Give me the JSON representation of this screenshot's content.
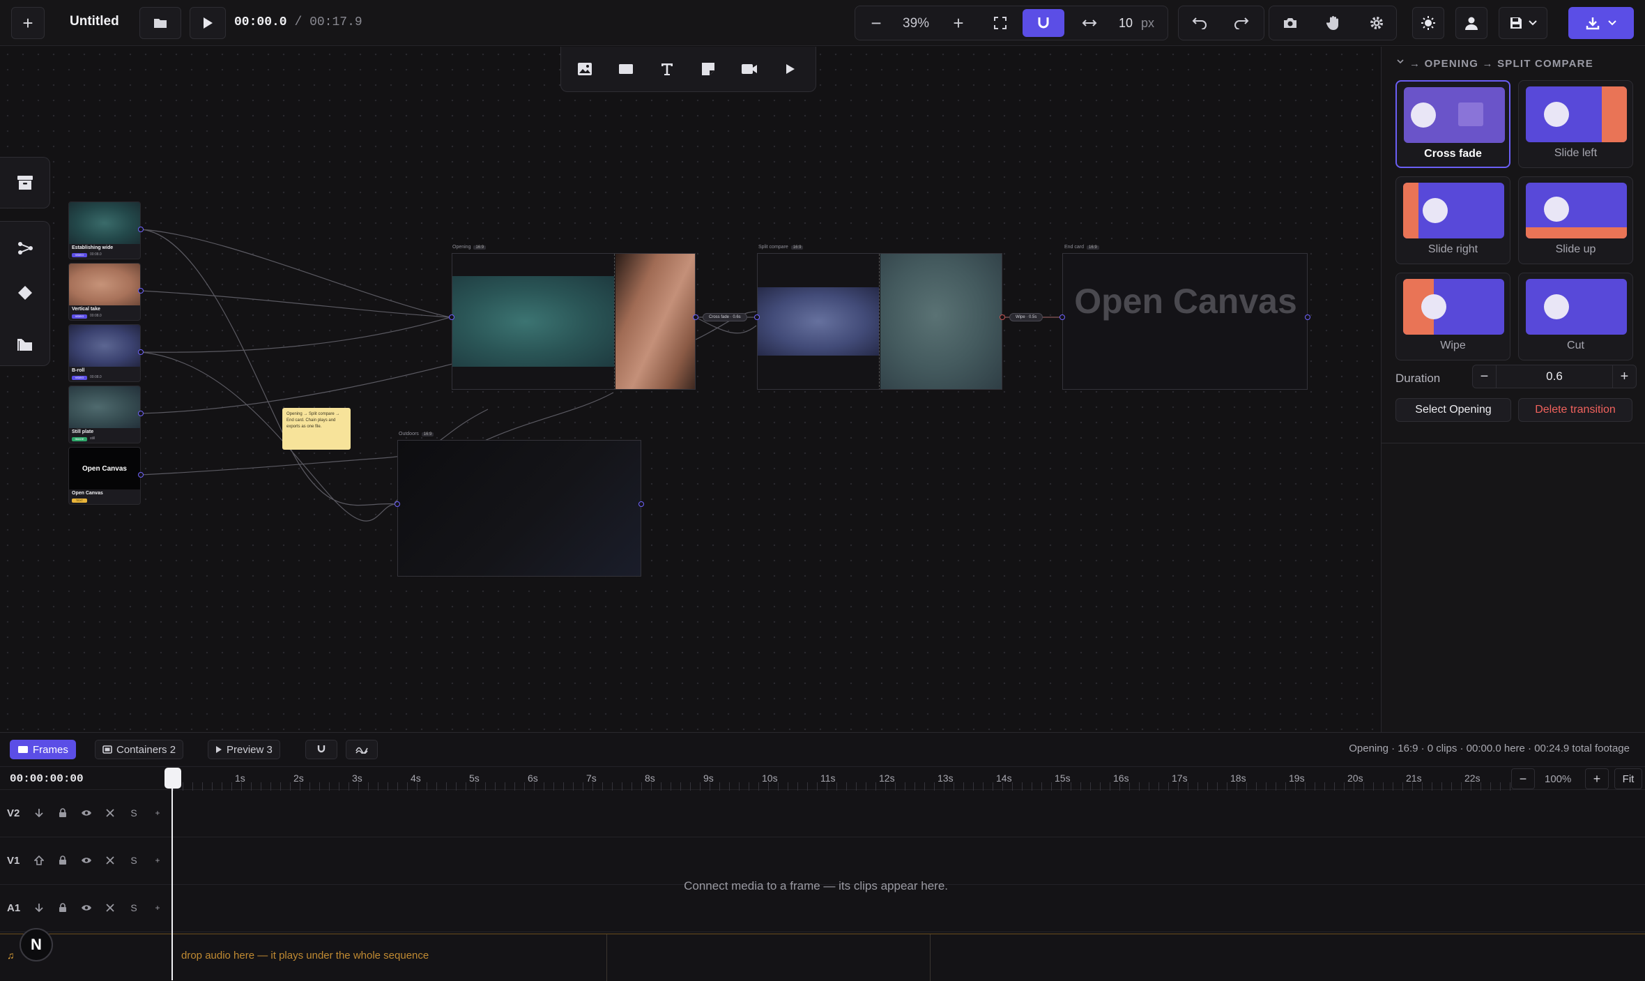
{
  "topbar": {
    "new_label": "+",
    "doc_title": "Untitled",
    "time_current": "00:00.0",
    "time_sep": "/",
    "time_total": "00:17.9",
    "zoom_minus": "−",
    "zoom_value": "39%",
    "zoom_plus": "+",
    "snap_value": "10",
    "snap_unit": "px"
  },
  "float_tools": [
    "image-icon",
    "rectangle-icon",
    "text-icon",
    "sticky-note-icon",
    "video-icon",
    "play-icon"
  ],
  "canvas": {
    "media": [
      {
        "title": "Establishing wide",
        "badge": "VIDEO",
        "meta": "00:08.0"
      },
      {
        "title": "Vertical take",
        "badge": "VIDEO",
        "meta": "00:08.0"
      },
      {
        "title": "B-roll",
        "badge": "VIDEO",
        "meta": "00:08.0"
      },
      {
        "title": "Still plate",
        "badge": "IMAGE",
        "meta": "still"
      },
      {
        "title": "Open Canvas",
        "badge": "TEXT",
        "meta": "",
        "thumb_text": "Open Canvas"
      }
    ],
    "frames": {
      "opening": {
        "label": "Opening",
        "tag": "16:9"
      },
      "split": {
        "label": "Split compare",
        "tag": "16:9"
      },
      "endcard": {
        "label": "End card",
        "tag": "16:9",
        "text": "Open Canvas"
      },
      "outdoors": {
        "label": "Outdoors",
        "tag": "16:9"
      }
    },
    "transitions": {
      "t1": "Cross fade · 0.6s",
      "t2": "Wipe · 0.5s"
    },
    "sticky_text": "Opening → Split compare → End card. Chain plays and exports as one file."
  },
  "panel": {
    "title": "→ OPENING → SPLIT COMPARE",
    "cards": [
      "Cross fade",
      "Slide left",
      "Slide right",
      "Slide up",
      "Wipe",
      "Cut"
    ],
    "duration_label": "Duration",
    "duration_value": "0.6",
    "minus": "−",
    "plus": "+",
    "select_label": "Select Opening",
    "delete_label": "Delete transition"
  },
  "bottom": {
    "tabs": {
      "frames": "Frames",
      "containers": "Containers 2",
      "preview": "Preview 3"
    },
    "status": "Opening · 16:9 · 0 clips · 00:00.0 here · 00:24.9 total footage",
    "timecode": "00:00:00:00",
    "ruler": [
      "1s",
      "2s",
      "3s",
      "4s",
      "5s",
      "6s",
      "7s",
      "8s",
      "9s",
      "10s",
      "11s",
      "12s",
      "13s",
      "14s",
      "15s",
      "16s",
      "17s",
      "18s",
      "19s",
      "20s",
      "21s",
      "22s"
    ],
    "zoom_minus": "−",
    "zoom_value": "100%",
    "zoom_plus": "+",
    "fit_label": "Fit",
    "tracks": [
      "V2",
      "V1",
      "A1"
    ],
    "track_solo": "S",
    "track_add": "+",
    "empty_message": "Connect media to a frame — its clips appear here.",
    "audio_hint": "drop audio here — it plays under the whole sequence",
    "avatar_letter": "N"
  },
  "colors": {
    "accent": "#5b4ee6",
    "danger": "#f0625d",
    "coral": "#e97456",
    "sticky": "#f7e39a"
  }
}
